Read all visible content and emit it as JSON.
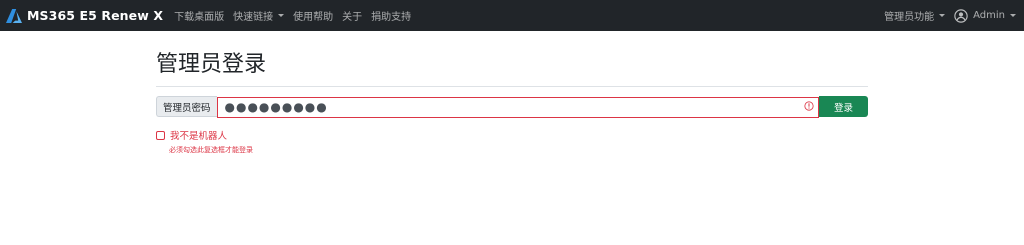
{
  "navbar": {
    "brand": "MS365 E5 Renew X",
    "links": [
      {
        "label": "下载桌面版"
      },
      {
        "label": "快速链接"
      },
      {
        "label": "使用帮助"
      },
      {
        "label": "关于"
      },
      {
        "label": "捐助支持"
      }
    ],
    "admin_menu": "管理员功能",
    "user": "Admin"
  },
  "page": {
    "title": "管理员登录"
  },
  "form": {
    "password_label": "管理员密码",
    "password_value": "●●●●●●●●●",
    "login_button": "登录",
    "captcha_label": "我不是机器人",
    "captcha_error": "必须勾选此复选框才能登录"
  },
  "colors": {
    "navbar_bg": "#212529",
    "brand_accent": "#2f8fe0",
    "danger": "#dc3545",
    "success": "#198754"
  }
}
